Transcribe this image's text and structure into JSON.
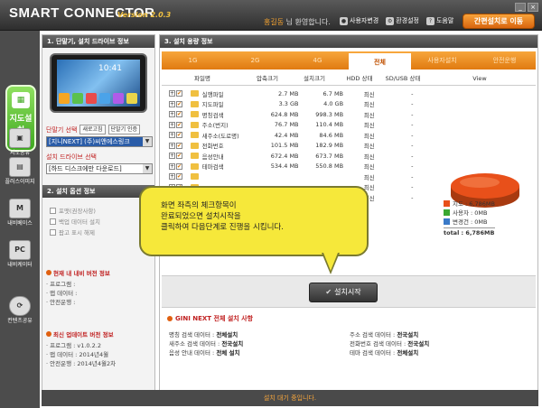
{
  "app": {
    "title": "SMART CONNECTOR",
    "version": "Version 2.0.3",
    "user_name": "홍길동",
    "user_suffix": "님 환영합니다.",
    "links": [
      {
        "label": "사용자변경",
        "icon": "user-icon"
      },
      {
        "label": "환경설정",
        "icon": "gear-icon"
      },
      {
        "label": "도움말",
        "icon": "help-icon"
      }
    ],
    "quick_button": "간편설치로 이동"
  },
  "sidebar": {
    "active": {
      "label": "지도설치",
      "icon": "map-icon"
    },
    "items": [
      {
        "label": "지도공유",
        "icon": "share-icon"
      },
      {
        "label": "플러스이미지",
        "icon": "image-icon"
      },
      {
        "label": "내비베이스",
        "icon": "base-icon"
      },
      {
        "label": "내비케이터",
        "icon": "pc-icon"
      },
      {
        "label": "컨텐츠공유",
        "icon": "sync-icon"
      }
    ]
  },
  "left": {
    "section1": "1. 단말기, 설치 드라이브 정보",
    "device_clock": "10:41",
    "device_label": "단말기 선택",
    "btn_refresh": "새로고침",
    "btn_auth": "단말기 인증",
    "device_value": "[지니NEXT] (주)씨앤에스링크",
    "drive_label": "설치 드라이브 선택",
    "drive_value": "[하드 디스크에만 다운로드]",
    "section2": "2. 설치 옵션 정보",
    "options": [
      "포맷(권장사항)",
      "백업 데이터 설치",
      "팝고 표시 해제"
    ],
    "current_title": "현재 내 내비 버전 정보",
    "current": [
      "· 프로그램 :",
      "· 맵 데이터 :",
      "· 안전운행 :"
    ],
    "latest_title": "최신 업데이트 버전 정보",
    "latest": [
      "· 프로그램  :  v1.0.2.2",
      "· 맵 데이터  :  2014년4월",
      "· 안전운행  :  2014년4월2차"
    ]
  },
  "main": {
    "section": "3. 설치 용량 정보",
    "tabs": [
      "1G",
      "2G",
      "4G",
      "전체",
      "사용자설치",
      "안전운행"
    ],
    "active_tab": 3,
    "headers": [
      "파일명",
      "압축크기",
      "설치크기",
      "HDD 상태",
      "SD/USB 상태",
      "View"
    ],
    "rows": [
      {
        "name": "실행파일",
        "zip": "2.7 MB",
        "inst": "6.7 MB",
        "hdd": "최신",
        "sd": "-"
      },
      {
        "name": "지도파일",
        "zip": "3.3 GB",
        "inst": "4.0 GB",
        "hdd": "최신",
        "sd": "-"
      },
      {
        "name": "명칭검색",
        "zip": "624.8 MB",
        "inst": "998.3 MB",
        "hdd": "최신",
        "sd": "-"
      },
      {
        "name": "주소(번지)",
        "zip": "76.7 MB",
        "inst": "110.4 MB",
        "hdd": "최신",
        "sd": "-"
      },
      {
        "name": "새주소(도로명)",
        "zip": "42.4 MB",
        "inst": "84.6 MB",
        "hdd": "최신",
        "sd": "-"
      },
      {
        "name": "전화번호",
        "zip": "101.5 MB",
        "inst": "182.9 MB",
        "hdd": "최신",
        "sd": "-"
      },
      {
        "name": "음성안내",
        "zip": "672.4 MB",
        "inst": "673.7 MB",
        "hdd": "최신",
        "sd": "-"
      },
      {
        "name": "테마검색",
        "zip": "534.4 MB",
        "inst": "550.8 MB",
        "hdd": "최신",
        "sd": "-"
      },
      {
        "name": "",
        "zip": "",
        "inst": "",
        "hdd": "최신",
        "sd": "-"
      },
      {
        "name": "",
        "zip": "",
        "inst": "",
        "hdd": "최신",
        "sd": "-"
      },
      {
        "name": "",
        "zip": "",
        "inst": "",
        "hdd": "최신",
        "sd": "-"
      }
    ],
    "legend": [
      {
        "label": "지도 : 6,786MB",
        "color": "#e8501a"
      },
      {
        "label": "사용자 : 0MB",
        "color": "#3aa832"
      },
      {
        "label": "변경건 : 0MB",
        "color": "#3a7ac8"
      }
    ],
    "total": "total : 6,786MB",
    "install_button": "설치시작",
    "status_title": "GINI NEXT 전체 설치 사항",
    "status": [
      [
        "명칭 검색 데이터    :",
        "전체설치",
        "주소 검색 데이터    :",
        "전국설치"
      ],
      [
        "새주소 검색 데이터 :",
        "전국설치",
        "전화번호 검색 데이터 :",
        "전국설치"
      ],
      [
        "음성 안내 데이터    :",
        "전체 설치",
        "테마 검색 데이터    :",
        "전체설치"
      ]
    ]
  },
  "bottom_status": "설치 대기 중입니다.",
  "balloon": {
    "lines": [
      "화면 좌측의 체크항목이",
      "완료되었으면 설치시작을",
      "클릭하여 다음단계로 진행을 시킵니다."
    ]
  }
}
